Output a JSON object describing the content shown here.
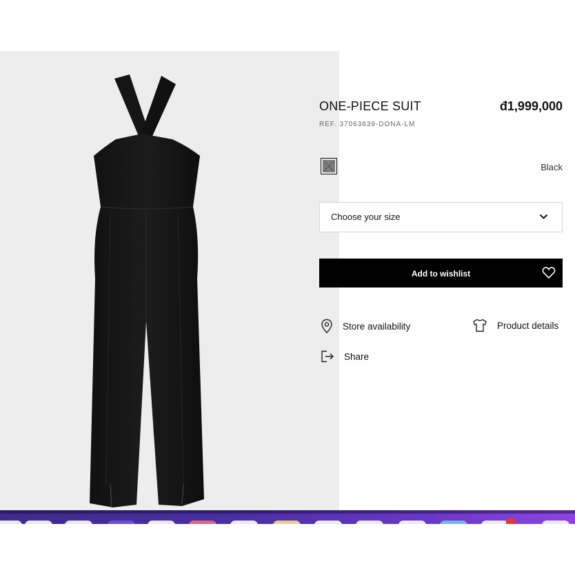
{
  "product": {
    "title": "ONE-PIECE SUIT",
    "price": "đ1,999,000",
    "reference": "REF. 37063839-DONA-LM",
    "image_icon": "black-jumpsuit-product-image"
  },
  "color": {
    "selected_name": "Black",
    "swatch_color": "#7d7d7d"
  },
  "size_selector": {
    "placeholder": "Choose your size",
    "icon": "chevron-down-icon"
  },
  "wishlist_button": {
    "label": "Add to wishlist",
    "icon": "heart-icon"
  },
  "links": {
    "store_availability": "Store availability",
    "product_details": "Product details",
    "share": "Share"
  },
  "colors": {
    "image_background": "#ededee",
    "button_background": "#000000",
    "taskbar_accent": "#6a38c8"
  }
}
